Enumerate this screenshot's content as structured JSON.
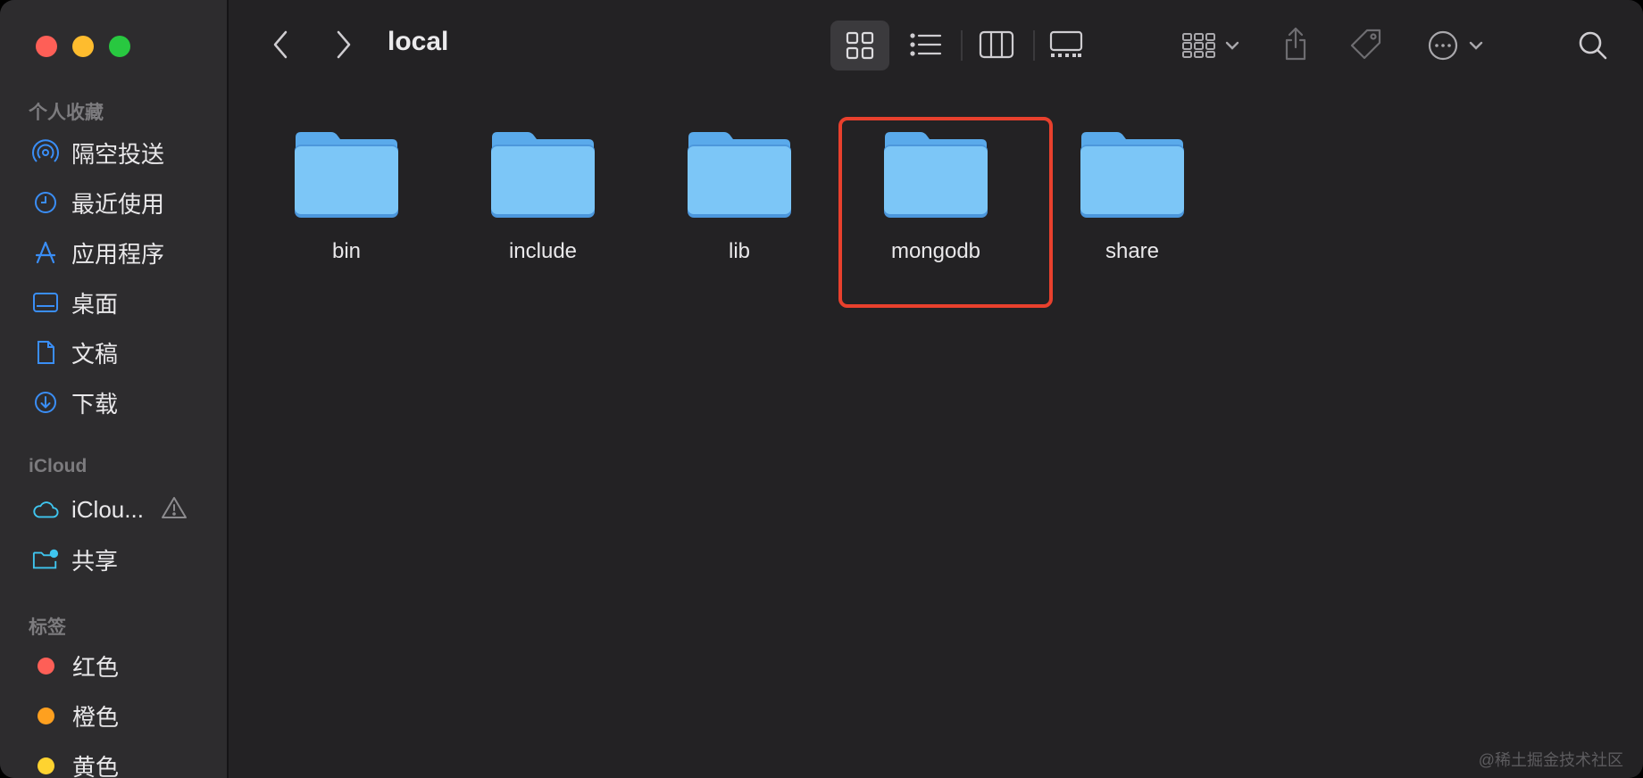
{
  "window": {
    "title": "local"
  },
  "sidebar": {
    "favorites_title": "个人收藏",
    "favorites": [
      {
        "label": "隔空投送",
        "icon": "airdrop-icon"
      },
      {
        "label": "最近使用",
        "icon": "clock-icon"
      },
      {
        "label": "应用程序",
        "icon": "applications-icon"
      },
      {
        "label": "桌面",
        "icon": "desktop-icon"
      },
      {
        "label": "文稿",
        "icon": "document-icon"
      },
      {
        "label": "下载",
        "icon": "download-icon"
      }
    ],
    "icloud_title": "iCloud",
    "icloud": [
      {
        "label": "iClou...",
        "icon": "cloud-icon",
        "badge": "warning-icon"
      },
      {
        "label": "共享",
        "icon": "shared-folder-icon"
      }
    ],
    "tags_title": "标签",
    "tags": [
      {
        "label": "红色",
        "color": "#fe5f57"
      },
      {
        "label": "橙色",
        "color": "#fea01f"
      },
      {
        "label": "黄色",
        "color": "#fed330"
      }
    ]
  },
  "toolbar": {
    "back_icon": "chevron-left-icon",
    "forward_icon": "chevron-right-icon",
    "view_modes": [
      "icon-view-icon",
      "list-view-icon",
      "column-view-icon",
      "gallery-view-icon"
    ],
    "active_view": "icon-view-icon",
    "group_icon": "group-icon",
    "share_icon": "share-icon",
    "tag_icon": "tag-icon",
    "more_icon": "ellipsis-circle-icon",
    "search_icon": "search-icon"
  },
  "folders": [
    {
      "name": "bin"
    },
    {
      "name": "include"
    },
    {
      "name": "lib"
    },
    {
      "name": "mongodb",
      "highlighted": true
    },
    {
      "name": "share"
    }
  ],
  "colors": {
    "accent": "#3a8ef6",
    "folder": "#7cc6f7",
    "highlight": "#e8402d"
  },
  "watermark": "@稀土掘金技术社区"
}
